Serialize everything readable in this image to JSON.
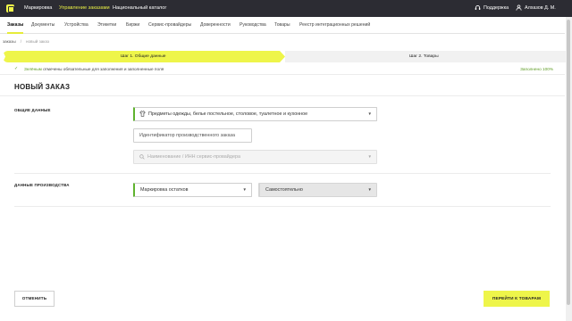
{
  "topbar": {
    "nav": [
      "Маркировка",
      "Управление заказами",
      "Национальный каталог"
    ],
    "support": "Поддержка",
    "user": "Алхазов Д. М.",
    "accent": "#e8ee45"
  },
  "subnav": {
    "tabs": [
      "Заказы",
      "Документы",
      "Устройства",
      "Этикетки",
      "Биржи",
      "Сервис-провайдеры",
      "Доверенности",
      "Руководства",
      "Товары",
      "Реестр интеграционных решений"
    ]
  },
  "breadcrumb": {
    "root": "заказы",
    "sep": "/",
    "current": "новый заказ"
  },
  "steps": {
    "step1": "Шаг 1. Общие данные",
    "step2": "Шаг 2. Товары"
  },
  "notice": {
    "highlight": "Зелёным",
    "text": "отмечены обязательные для заполнения и заполненные поля",
    "filled": "Заполнено 100%"
  },
  "page_title": "НОВЫЙ ЗАКАЗ",
  "general": {
    "label": "ОБЩИЕ ДАННЫЕ",
    "product_group": "Предметы одежды, белье постельное, столовое, туалетное и кухонное",
    "order_id_placeholder": "Идентификатор производственного заказа",
    "provider_placeholder": "Наименование / ИНН сервис-провайдера"
  },
  "production": {
    "label": "ДАННЫЕ ПРОИЗВОДСТВА",
    "type": "Маркировка остатков",
    "method": "Самостоятельно"
  },
  "buttons": {
    "cancel": "ОТМЕНИТЬ",
    "next": "ПЕРЕЙТИ К ТОВАРАМ"
  },
  "colors": {
    "brand_yellow": "#eef54a",
    "ok_green": "#5fb32e",
    "topbar": "#2c2c33"
  }
}
